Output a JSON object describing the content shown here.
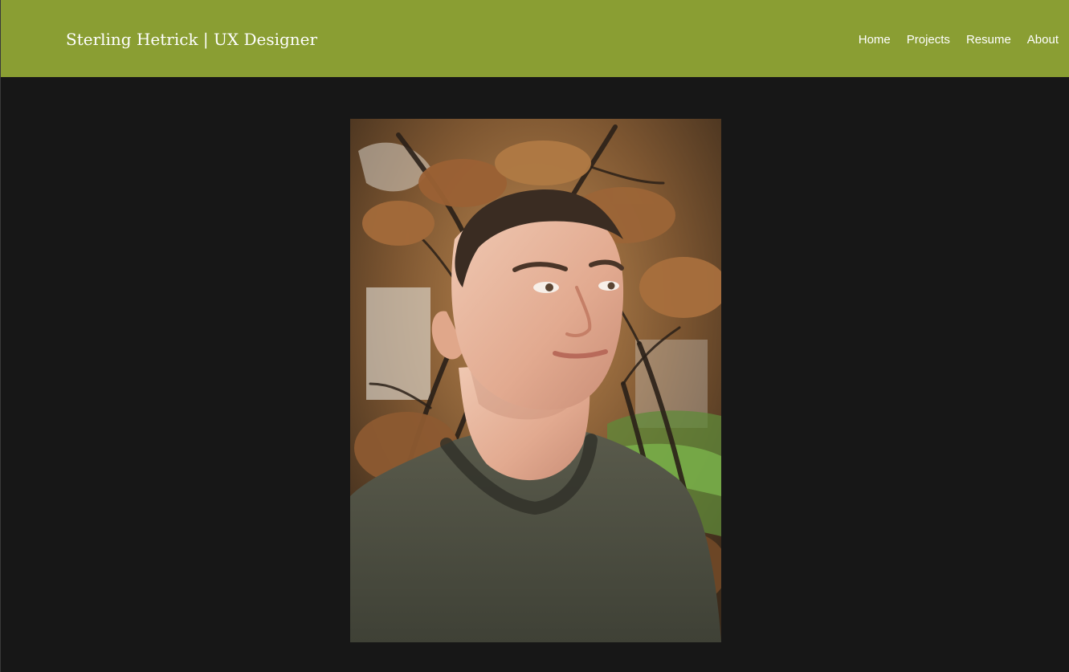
{
  "header": {
    "site_title": "Sterling Hetrick | UX Designer",
    "background_color": "#8a9e33"
  },
  "nav": {
    "items": [
      {
        "label": "Home"
      },
      {
        "label": "Projects"
      },
      {
        "label": "Resume"
      },
      {
        "label": "About"
      }
    ]
  },
  "main": {
    "background_color": "#171717",
    "portrait": {
      "alt": "Portrait photo of a man in a dark green t-shirt in front of a tree with brown autumn leaves"
    }
  }
}
